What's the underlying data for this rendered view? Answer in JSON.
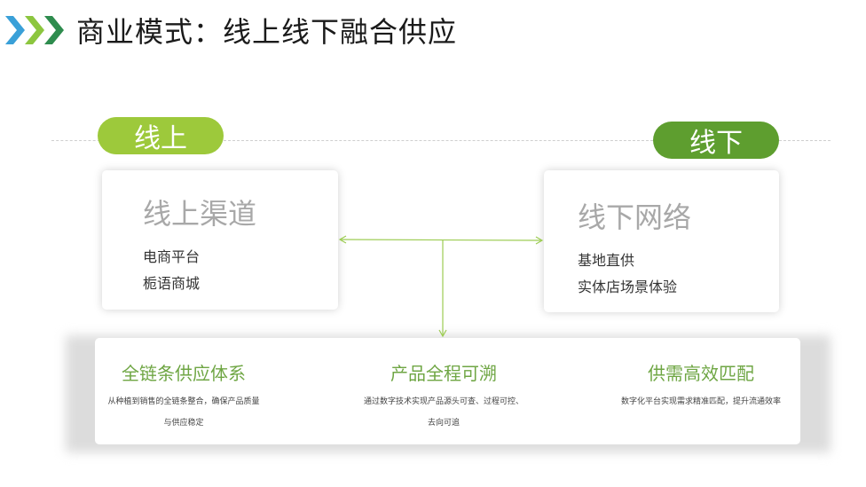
{
  "title": "商业模式：线上线下融合供应",
  "icons": {
    "header": "triple-chevron-right-icon"
  },
  "colors": {
    "online_pill": "#9dc93b",
    "offline_pill": "#5e9e2f",
    "feature_title": "#6fa644",
    "connector": "#9ccc52",
    "chevron_blue": "#3aa0d8",
    "chevron_green": "#8cc63f",
    "chevron_dark": "#2e8c4e"
  },
  "online": {
    "badge": "线上",
    "card_title": "线上渠道",
    "items": [
      "电商平台",
      "栀语商城"
    ]
  },
  "offline": {
    "badge": "线下",
    "card_title": "线下网络",
    "items": [
      "基地直供",
      "实体店场景体验"
    ]
  },
  "features": [
    {
      "title": "全链条供应体系",
      "desc": [
        "从种植到销售的全链条整合，确保产品质量",
        "与供应稳定"
      ]
    },
    {
      "title": "产品全程可溯",
      "desc": [
        "通过数字技术实现产品源头可查、过程可控、",
        "去向可追"
      ]
    },
    {
      "title": "供需高效匹配",
      "desc": [
        "数字化平台实现需求精准匹配，提升流通效率"
      ]
    }
  ]
}
